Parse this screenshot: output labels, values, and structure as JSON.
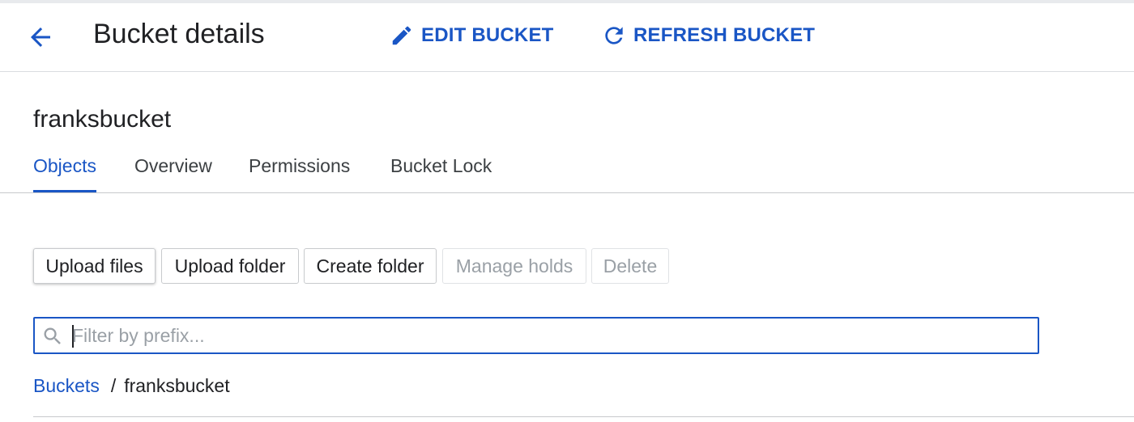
{
  "header": {
    "back_icon": "arrow-left-icon",
    "title": "Bucket details",
    "edit_label": "EDIT BUCKET",
    "edit_icon": "pencil-icon",
    "refresh_label": "REFRESH BUCKET",
    "refresh_icon": "refresh-icon"
  },
  "bucket": {
    "name": "franksbucket"
  },
  "tabs": [
    {
      "label": "Objects",
      "active": true
    },
    {
      "label": "Overview",
      "active": false
    },
    {
      "label": "Permissions",
      "active": false
    },
    {
      "label": "Bucket Lock",
      "active": false
    }
  ],
  "toolbar": {
    "upload_files": "Upload files",
    "upload_folder": "Upload folder",
    "create_folder": "Create folder",
    "manage_holds": "Manage holds",
    "delete": "Delete"
  },
  "filter": {
    "placeholder": "Filter by prefix...",
    "value": "",
    "icon": "search-icon"
  },
  "breadcrumb": {
    "root": "Buckets",
    "separator": "/",
    "current": "franksbucket"
  },
  "colors": {
    "accent": "#1a56c5",
    "text": "#202124",
    "disabled": "#9aa0a6"
  }
}
